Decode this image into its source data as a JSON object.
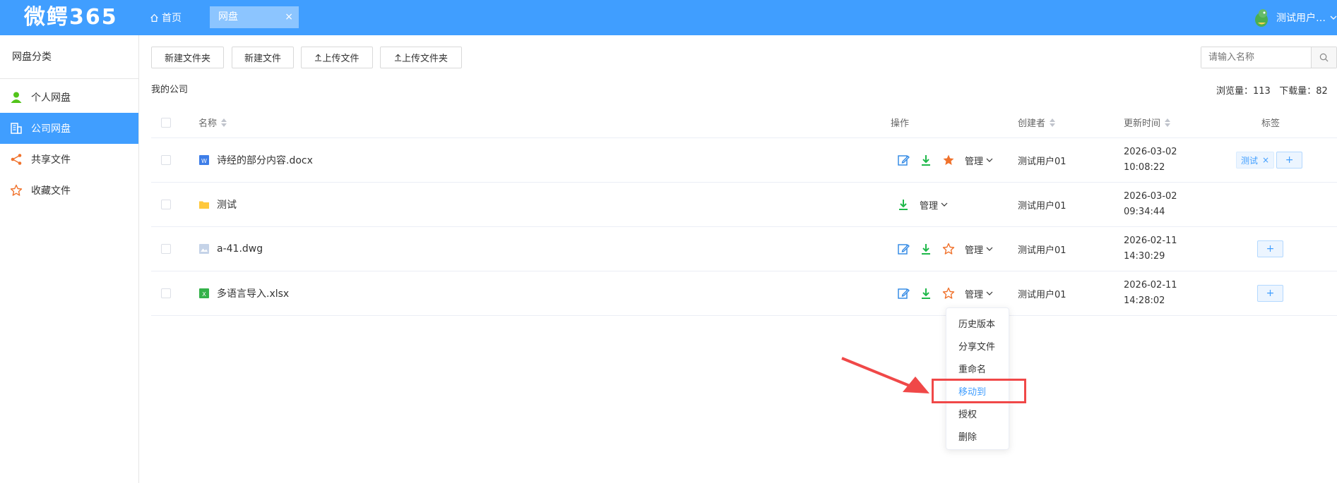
{
  "header": {
    "logo": "微鳄365",
    "home": "首页",
    "tab": "网盘",
    "tab_close": "×",
    "user": "测试用户…"
  },
  "sidebar": {
    "title": "网盘分类",
    "items": [
      {
        "label": "个人网盘",
        "icon": "user-icon"
      },
      {
        "label": "公司网盘",
        "icon": "building-icon"
      },
      {
        "label": "共享文件",
        "icon": "share-icon"
      },
      {
        "label": "收藏文件",
        "icon": "star-icon"
      }
    ]
  },
  "toolbar": {
    "new_folder": "新建文件夹",
    "new_file": "新建文件",
    "upload_file": "上传文件",
    "upload_folder": "上传文件夹",
    "search_placeholder": "请输入名称"
  },
  "breadcrumb": "我的公司",
  "stats": {
    "views_label": "浏览量：",
    "views": "113",
    "downloads_label": "下载量：",
    "downloads": "82"
  },
  "table": {
    "headers": {
      "name": "名称",
      "actions": "操作",
      "creator": "创建者",
      "updated": "更新时间",
      "tags": "标签"
    },
    "rows": [
      {
        "name": "诗经的部分内容.docx",
        "type": "word",
        "manage": "管理",
        "creator": "测试用户01",
        "date": "2026-03-02",
        "time": "10:08:22",
        "tag": "测试",
        "starred": true
      },
      {
        "name": "测试",
        "type": "folder",
        "manage": "管理",
        "creator": "测试用户01",
        "date": "2026-03-02",
        "time": "09:34:44"
      },
      {
        "name": "a-41.dwg",
        "type": "image",
        "manage": "管理",
        "creator": "测试用户01",
        "date": "2026-02-11",
        "time": "14:30:29",
        "starred": false
      },
      {
        "name": "多语言导入.xlsx",
        "type": "excel",
        "manage": "管理",
        "creator": "测试用户01",
        "date": "2026-02-11",
        "time": "14:28:02",
        "starred": false
      }
    ]
  },
  "dropdown": {
    "items": [
      "历史版本",
      "分享文件",
      "重命名",
      "移动到",
      "授权",
      "删除"
    ],
    "highlighted": "移动到"
  },
  "colors": {
    "primary": "#409eff",
    "highlight": "#f04848",
    "star": "#f0722c",
    "download": "#1fb84a"
  }
}
